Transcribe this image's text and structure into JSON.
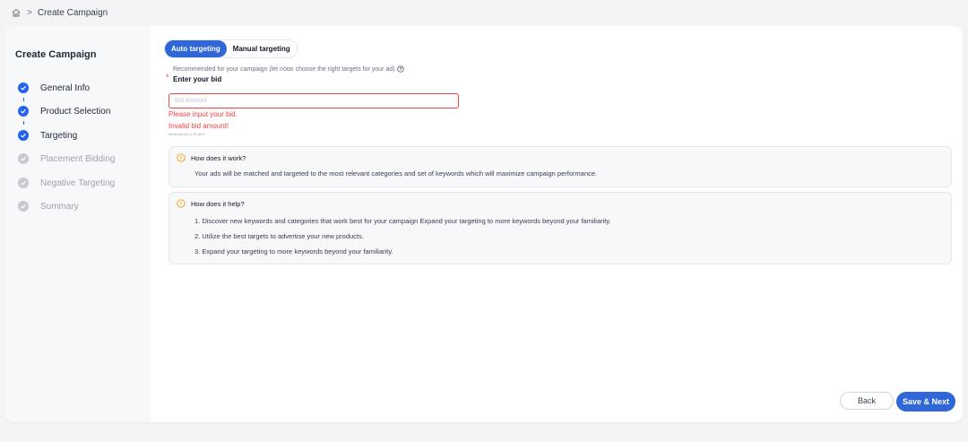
{
  "breadcrumb": {
    "icon": "home-icon",
    "separator": ">",
    "current": "Create Campaign"
  },
  "sidebar": {
    "title": "Create Campaign",
    "steps": [
      {
        "label": "General Info",
        "status": "done"
      },
      {
        "label": "Product Selection",
        "status": "done"
      },
      {
        "label": "Targeting",
        "status": "done"
      },
      {
        "label": "Placement Bidding",
        "status": "pending"
      },
      {
        "label": "Negative Targeting",
        "status": "pending"
      },
      {
        "label": "Summary",
        "status": "pending"
      }
    ]
  },
  "targeting": {
    "tabs": [
      {
        "label": "Auto targeting",
        "active": true
      },
      {
        "label": "Manual targeting",
        "active": false
      }
    ],
    "recommendation": "Recommended for your campaign (let noon choose the right targets for your ad)",
    "required_mark": "*",
    "bid_label": "Enter your bid",
    "bid_input": {
      "value": "",
      "placeholder": "Bid Amount"
    },
    "errors": [
      "Please input your bid.",
      "Invalid bid amount!"
    ],
    "min_bid_note": "Minimum bid 0.25 AED"
  },
  "info_boxes": [
    {
      "title": "How does it work?",
      "lines": [
        "Your ads will be matched and targeted to the most relevant categories and set of keywords which will maximize campaign performance."
      ]
    },
    {
      "title": "How does it help?",
      "lines": [
        "1. Discover new keywords and categories that work best for your campaign Expand your targeting to more keywords beyond your familiarity.",
        "2. Utilize the best targets to advertise your new products.",
        "3. Expand your targeting to more keywords beyond your familiarity."
      ]
    }
  ],
  "actions": {
    "back": "Back",
    "next": "Save & Next"
  },
  "colors": {
    "primary": "#2f66d8",
    "error": "#ef4444",
    "warning": "#f59e0b",
    "disabled": "#c7cbd1"
  }
}
